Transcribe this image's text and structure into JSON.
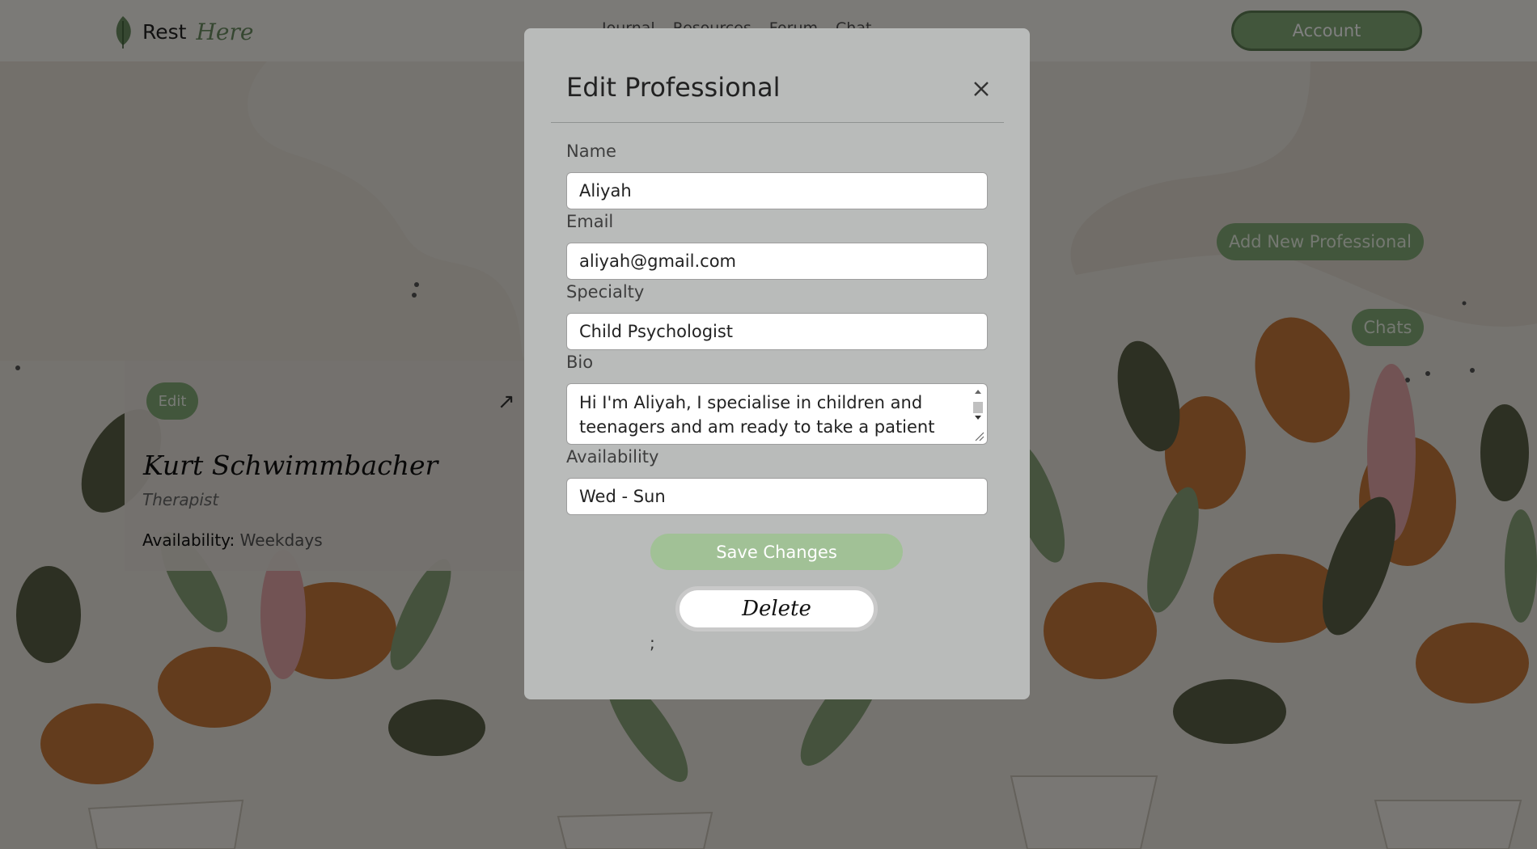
{
  "navbar": {
    "logo_rest": "Rest",
    "logo_here": "Here",
    "links": [
      "Journal",
      "Resources",
      "Forum",
      "Chat"
    ],
    "account_label": "Account"
  },
  "actions": {
    "add_professional_label": "Add New Professional",
    "chats_label": "Chats"
  },
  "card": {
    "edit_label": "Edit",
    "open_icon": "↗",
    "name": "Kurt Schwimmbacher",
    "role": "Therapist",
    "availability_label": "Availability:",
    "availability_value": "Weekdays"
  },
  "modal": {
    "title": "Edit Professional",
    "close_icon": "close-icon",
    "fields": {
      "name_label": "Name",
      "name_value": "Aliyah",
      "email_label": "Email",
      "email_value": "aliyah@gmail.com",
      "specialty_label": "Specialty",
      "specialty_value": "Child Psychologist",
      "bio_label": "Bio",
      "bio_value": "Hi I'm Aliyah, I specialise in children and teenagers and am ready to take a patient",
      "availability_label": "Availability",
      "availability_value": "Wed - Sun"
    },
    "save_label": "Save Changes",
    "delete_label": "Delete",
    "stray_text": ";"
  },
  "colors": {
    "accent_green": "#85ad78",
    "save_green": "#a1c196",
    "modal_bg": "#b9bbba"
  }
}
